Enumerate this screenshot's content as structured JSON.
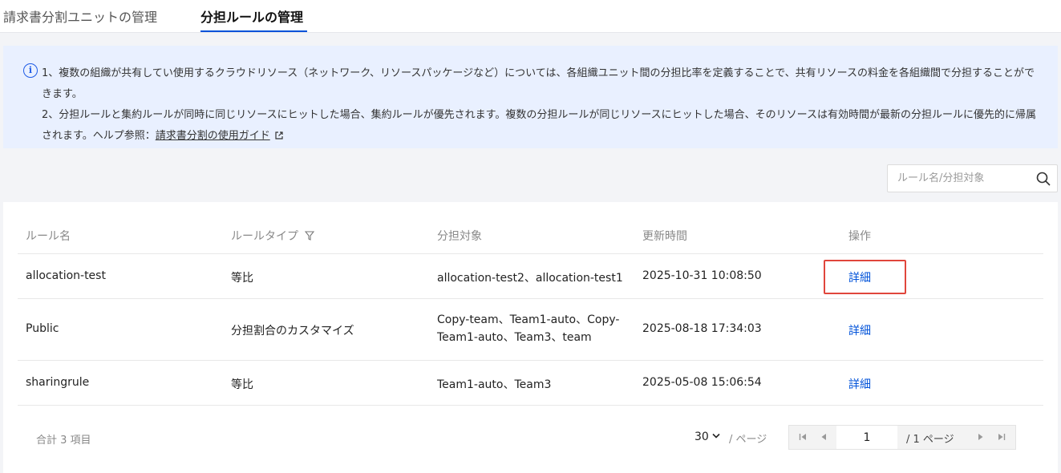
{
  "tabs": [
    {
      "label": "請求書分割ユニットの管理"
    },
    {
      "label": "分担ルールの管理"
    }
  ],
  "notice": {
    "line1": "1、複数の組織が共有してい使用するクラウドリソース（ネットワーク、リソースパッケージなど）については、各組織ユニット間の分担比率を定義することで、共有リソースの料金を各組織間で分担することができます。",
    "line2_prefix": "2、分担ルールと集約ルールが同時に同じリソースにヒットした場合、集約ルールが優先されます。複数の分担ルールが同じリソースにヒットした場合、そのリソースは有効時間が最新の分担ルールに優先的に帰属されます。ヘルプ参照：",
    "link": "請求書分割の使用ガイド"
  },
  "search": {
    "placeholder": "ルール名/分担対象"
  },
  "table": {
    "headers": [
      "ルール名",
      "ルールタイプ",
      "分担対象",
      "更新時間",
      "操作"
    ],
    "rows": [
      {
        "name": "allocation-test",
        "type": "等比",
        "targets": "allocation-test2、allocation-test1",
        "updated": "2025-10-31 10:08:50",
        "action": "詳細"
      },
      {
        "name": "Public",
        "type": "分担割合のカスタマイズ",
        "targets": "Copy-team、Team1-auto、Copy-Team1-auto、Team3、team",
        "updated": "2025-08-18 17:34:03",
        "action": "詳細"
      },
      {
        "name": "sharingrule",
        "type": "等比",
        "targets": "Team1-auto、Team3",
        "updated": "2025-05-08 15:06:54",
        "action": "詳細"
      }
    ]
  },
  "footer": {
    "total": "合計 3 項目",
    "page_size": "30",
    "page_unit": "/ ページ",
    "current_page": "1",
    "page_total": "/ 1 ページ"
  },
  "colors": {
    "accent": "#0052d9",
    "highlight": "#e0463c",
    "notice_bg": "#e9f0ff"
  }
}
